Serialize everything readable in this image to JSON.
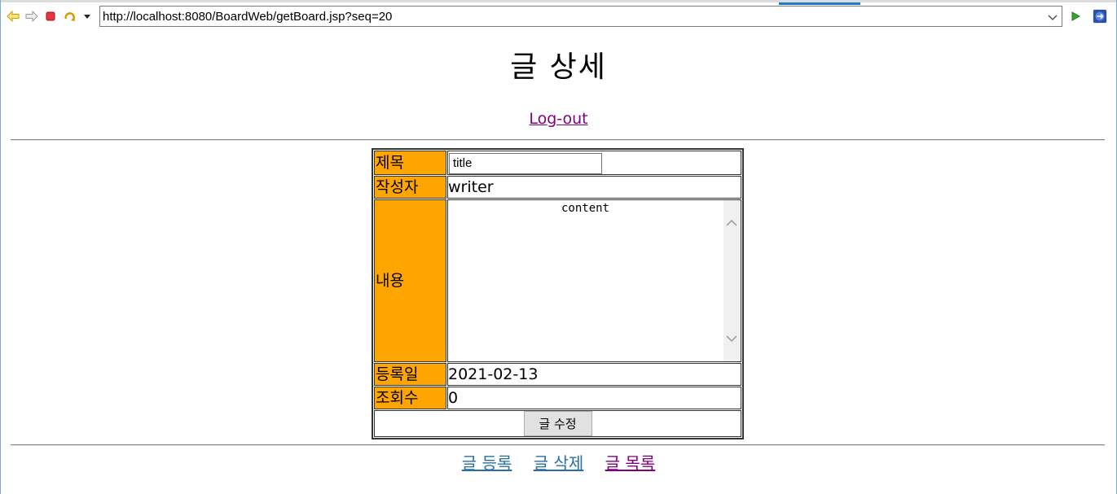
{
  "browser": {
    "url": "http://localhost:8080/BoardWeb/getBoard.jsp?seq=20"
  },
  "page": {
    "title": "글 상세",
    "logout_label": "Log-out"
  },
  "form": {
    "labels": {
      "title": "제목",
      "writer": "작성자",
      "content": "내용",
      "regdate": "등록일",
      "cnt": "조회수"
    },
    "title_value": "title",
    "writer_value": "writer",
    "content_value": "content",
    "regdate_value": "2021-02-13",
    "cnt_value": "0",
    "submit_label": "글 수정"
  },
  "links": {
    "insert": "글 등록",
    "delete": "글 삭제",
    "list": "글 목록"
  },
  "colors": {
    "label_bg": "#ffa500",
    "visited_link": "#800080",
    "link": "#2a6fa3"
  }
}
